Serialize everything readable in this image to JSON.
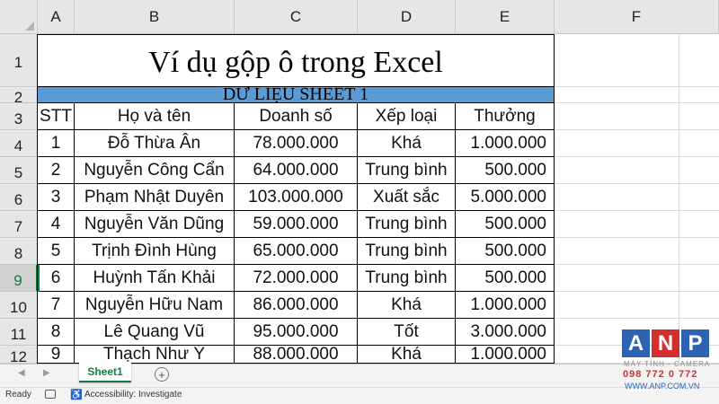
{
  "columns": [
    "A",
    "B",
    "C",
    "D",
    "E",
    "F"
  ],
  "rows": [
    "1",
    "2",
    "3",
    "4",
    "5",
    "6",
    "7",
    "8",
    "9",
    "10",
    "11",
    "12"
  ],
  "sheet": {
    "title": "Ví dụ gộp ô trong Excel",
    "banner": "DỮ LIỆU SHEET 1",
    "headers": [
      "STT",
      "Họ và tên",
      "Doanh số",
      "Xếp loại",
      "Thưởng"
    ],
    "data": [
      [
        "1",
        "Đỗ Thừa Ân",
        "78.000.000",
        "Khá",
        "1.000.000"
      ],
      [
        "2",
        "Nguyễn Công Cẩn",
        "64.000.000",
        "Trung bình",
        "500.000"
      ],
      [
        "3",
        "Phạm Nhật Duyên",
        "103.000.000",
        "Xuất sắc",
        "5.000.000"
      ],
      [
        "4",
        "Nguyễn Văn Dũng",
        "59.000.000",
        "Trung bình",
        "500.000"
      ],
      [
        "5",
        "Trịnh Đình Hùng",
        "65.000.000",
        "Trung bình",
        "500.000"
      ],
      [
        "6",
        "Huỳnh Tấn Khải",
        "72.000.000",
        "Trung bình",
        "500.000"
      ],
      [
        "7",
        "Nguyễn Hữu Nam",
        "86.000.000",
        "Khá",
        "1.000.000"
      ],
      [
        "8",
        "Lê Quang Vũ",
        "95.000.000",
        "Tốt",
        "3.000.000"
      ],
      [
        "9",
        "Thạch Như Ý",
        "88.000.000",
        "Khá",
        "1.000.000"
      ]
    ]
  },
  "selected_row": "9",
  "tabs": {
    "active": "Sheet1",
    "add": "+",
    "prev": "◀",
    "next": "▶"
  },
  "status": {
    "ready": "Ready",
    "accessibility": "Accessibility: Investigate"
  },
  "watermark": {
    "letters": [
      "A",
      "N",
      "P"
    ],
    "subtitle": "MÁY TÍNH - CAMERA",
    "phone": "098 772 0 772",
    "site": "WWW.ANP.COM.VN"
  },
  "colors": {
    "banner": "#5b9bd5",
    "accent": "#107c41",
    "logo_blue": "#2e63b3",
    "logo_red": "#d32f2f"
  }
}
